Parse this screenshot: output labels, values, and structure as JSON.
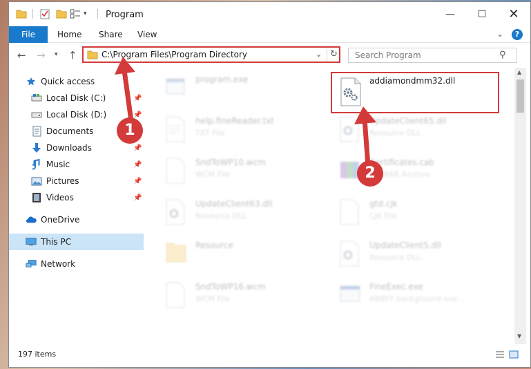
{
  "window": {
    "title": "Program"
  },
  "ribbon": {
    "tabs": [
      {
        "label": "File"
      },
      {
        "label": "Home"
      },
      {
        "label": "Share"
      },
      {
        "label": "View"
      }
    ],
    "help": "?"
  },
  "address": {
    "path": "C:\\Program Files\\Program Directory"
  },
  "search": {
    "placeholder": "Search Program"
  },
  "sidebar": {
    "items": [
      {
        "label": "Quick access"
      },
      {
        "label": "Local Disk (C:)"
      },
      {
        "label": "Local Disk (D:)"
      },
      {
        "label": "Documents"
      },
      {
        "label": "Downloads"
      },
      {
        "label": "Music"
      },
      {
        "label": "Pictures"
      },
      {
        "label": "Videos"
      },
      {
        "label": "OneDrive"
      },
      {
        "label": "This PC"
      },
      {
        "label": "Network"
      }
    ]
  },
  "files": [
    {
      "name": "program.exe",
      "type": ""
    },
    {
      "name": "addiamondmm32.dll",
      "type": ""
    },
    {
      "name": "help.fineReader.txt",
      "type": "TXT File"
    },
    {
      "name": "UpdateClient65.dll",
      "type": "Resource DLL"
    },
    {
      "name": "SndToWP10.wcm",
      "type": "WCM File"
    },
    {
      "name": "Certificates.cab",
      "type": "WinRAR Archive"
    },
    {
      "name": "UpdateClient63.dll",
      "type": "Resource DLL"
    },
    {
      "name": "gtd.cjk",
      "type": "CJK File"
    },
    {
      "name": "Resource",
      "type": ""
    },
    {
      "name": "UpdateClient5.dll",
      "type": "Resource DLL"
    },
    {
      "name": "SndToWP16.wcm",
      "type": "WCM File"
    },
    {
      "name": "FineExec.exe",
      "type": "ABBYY background exe..."
    }
  ],
  "status": {
    "count": "197 items"
  },
  "annotations": {
    "step1": "1",
    "step2": "2"
  },
  "colors": {
    "accent": "#1979ca",
    "highlight": "#d33a3a",
    "selected": "#cce4f7"
  }
}
